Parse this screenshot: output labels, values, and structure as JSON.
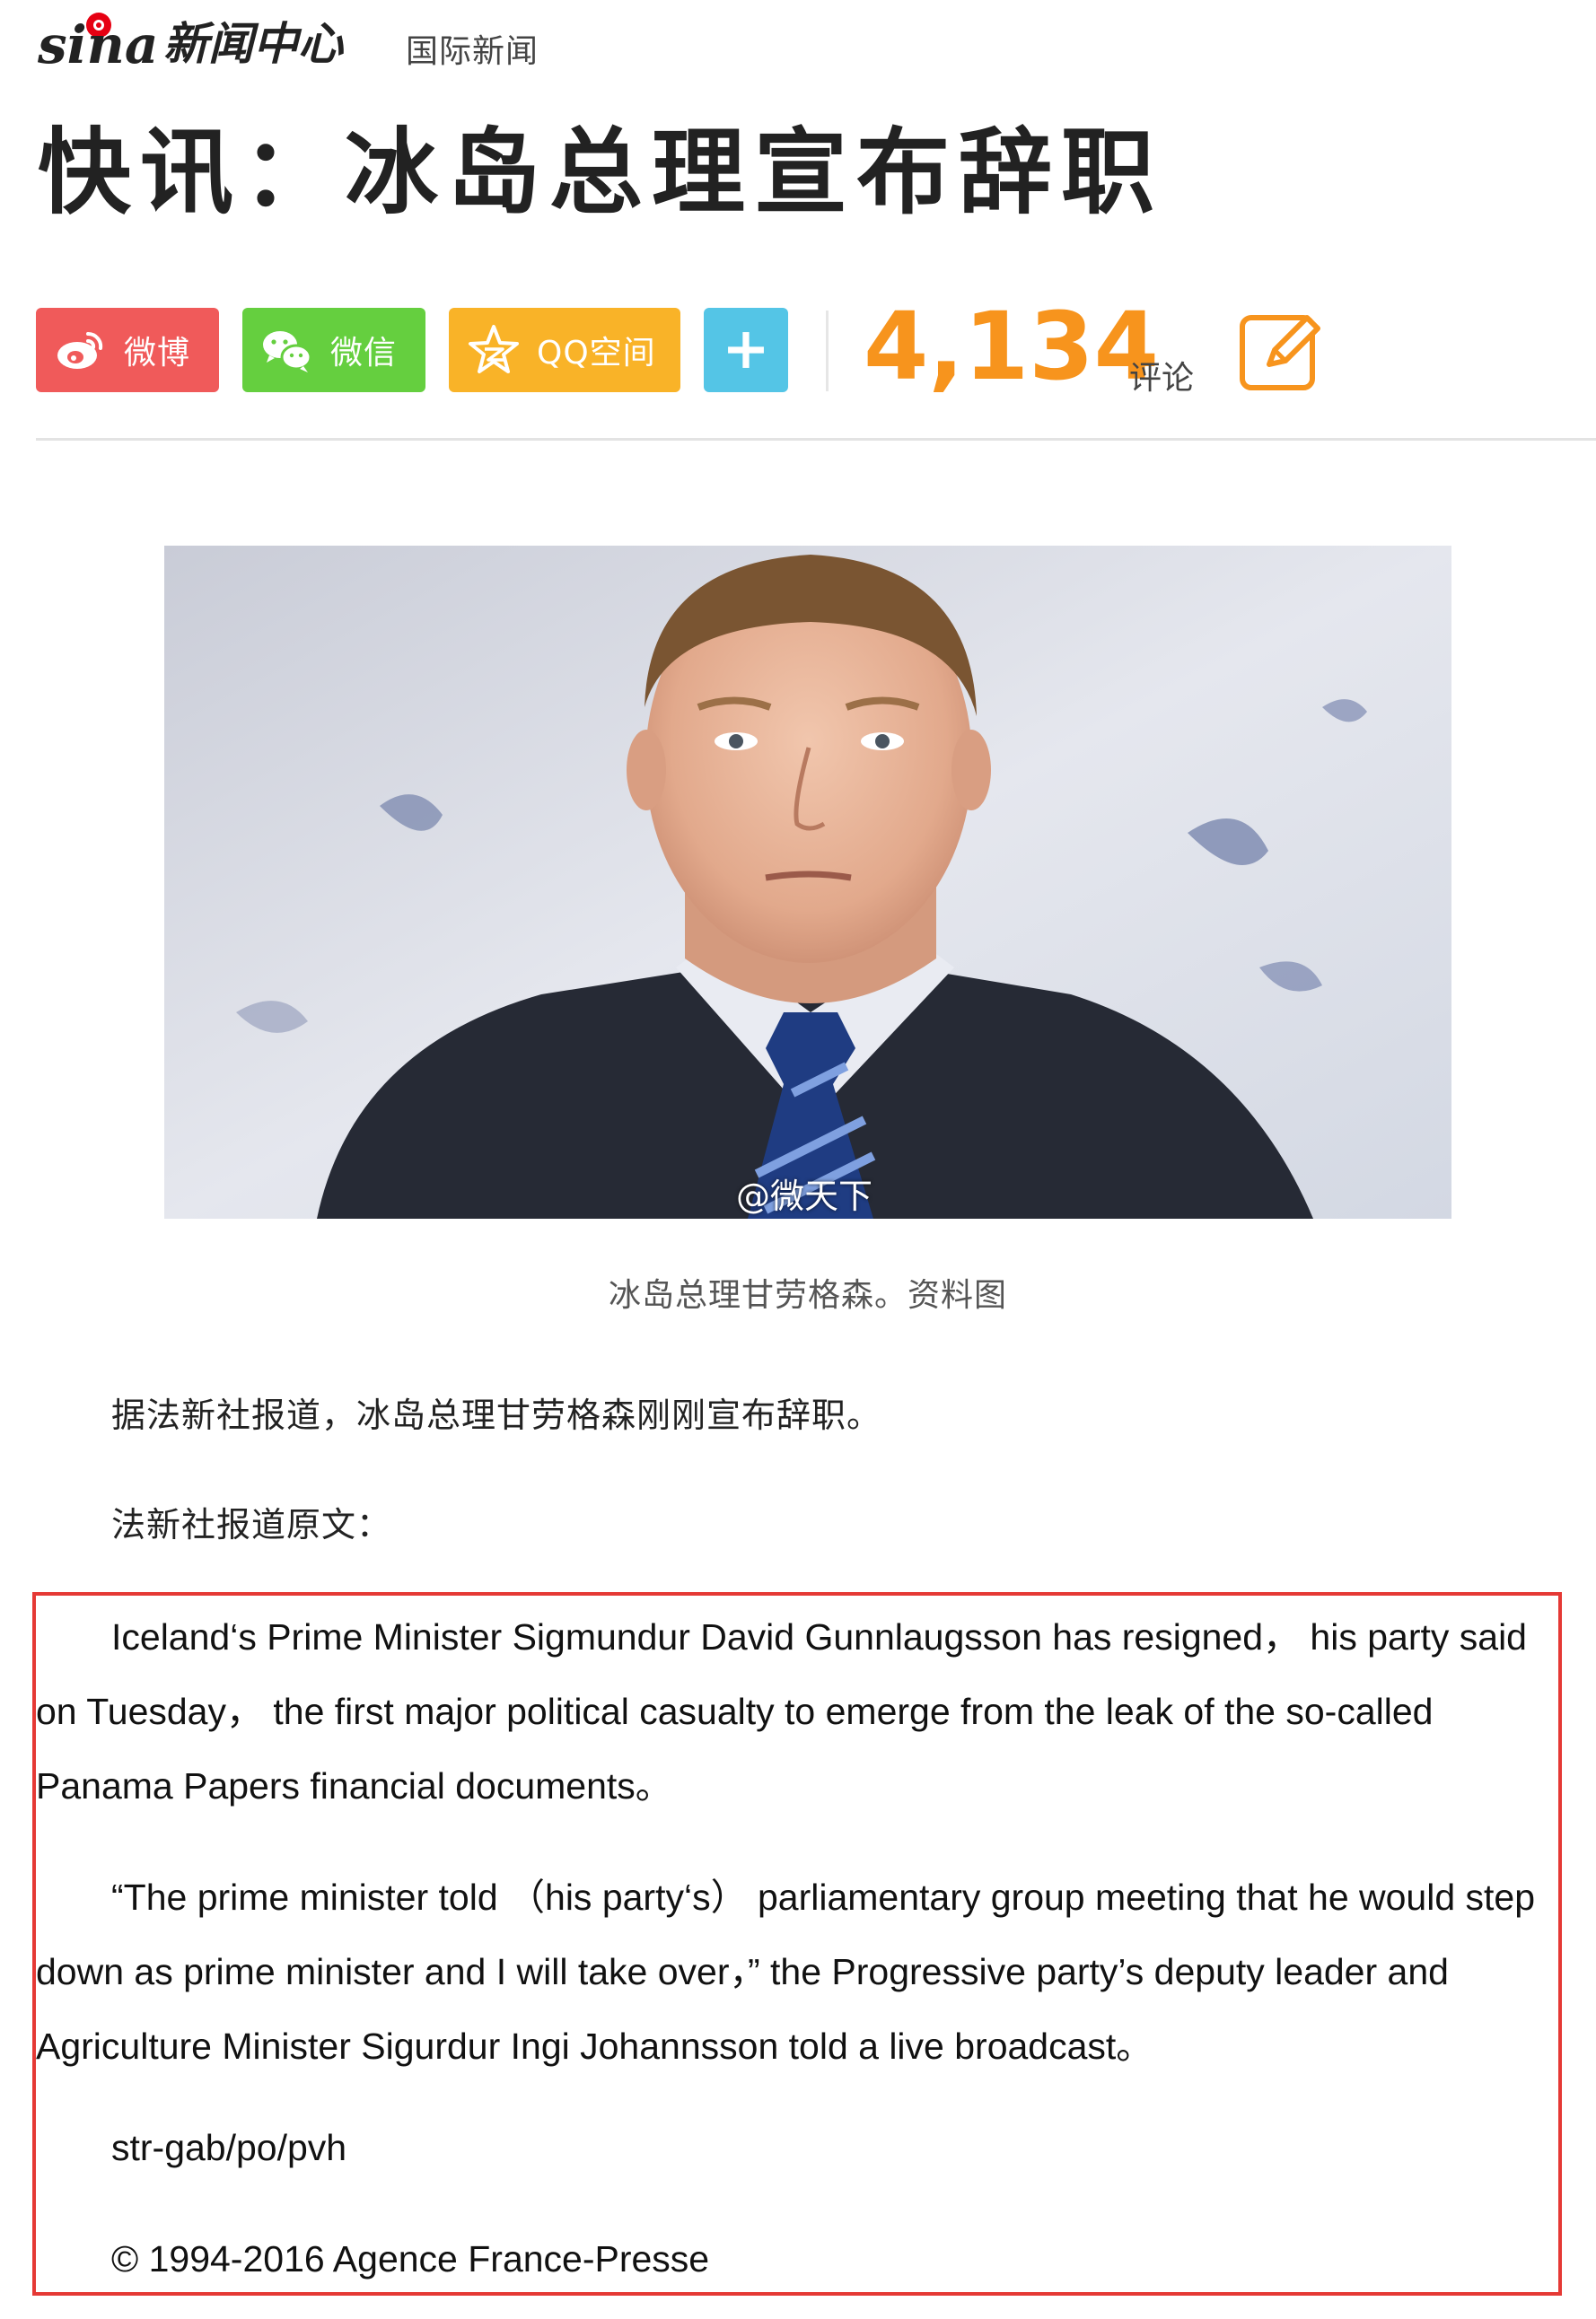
{
  "header": {
    "logo_text": "sina",
    "logo_channel": "新闻中心",
    "section": "国际新闻"
  },
  "article": {
    "headline": "快讯：冰岛总理宣布辞职",
    "photo": {
      "watermark": "@微天下",
      "caption": "冰岛总理甘劳格森。资料图"
    },
    "paragraphs": [
      "据法新社报道，冰岛总理甘劳格森刚刚宣布辞职。",
      "法新社报道原文："
    ],
    "quote": {
      "p1": [
        "Iceland‘s Prime Minister Sigmundur David Gunnlaugsson has resigned，  his party said",
        "on Tuesday，  the first major political casualty to emerge from the leak of the so-called",
        "Panama Papers financial documents。"
      ],
      "p2": [
        "“The prime minister told （his party‘s） parliamentary group meeting that he would step",
        "down as prime minister and I will take over，” the Progressive party’s deputy leader and",
        "Agriculture Minister Sigurdur Ingi Johannsson told a live broadcast。"
      ],
      "p3": "str-gab/po/pvh",
      "p4": "© 1994-2016 Agence France-Presse"
    }
  },
  "share": {
    "weibo_label": "微博",
    "wechat_label": "微信",
    "qzone_label": "QQ空间",
    "more_icon": "plus-icon",
    "comment_count": "4,134",
    "comment_label": "评论",
    "edit_icon": "pencil-edit-icon"
  },
  "colors": {
    "weibo": "#f05a5a",
    "wechat": "#65cf3f",
    "qzone": "#f9b328",
    "more": "#54c5e6",
    "comment_count": "#f7941d",
    "highlight_box": "#e53935",
    "brand_red": "#e60012"
  }
}
